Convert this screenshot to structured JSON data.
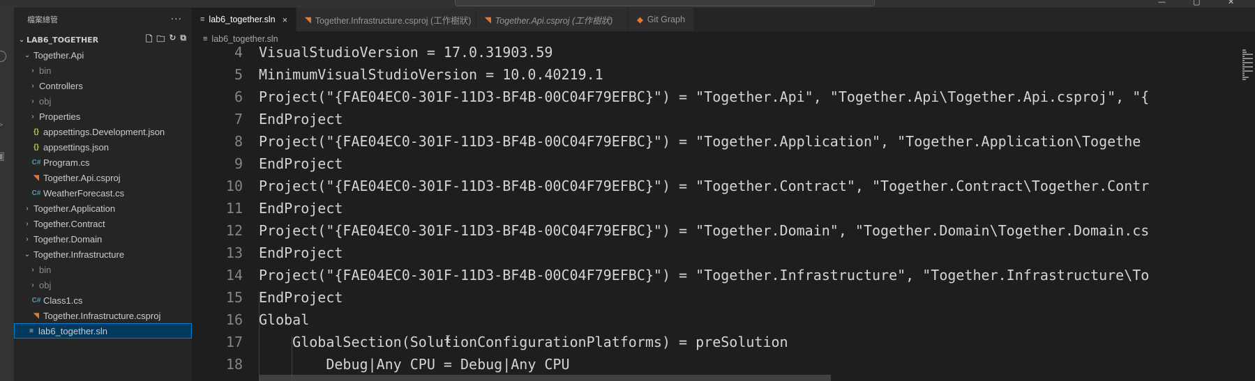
{
  "sidebar": {
    "title": "檔案總管",
    "more": "···",
    "root": "LAB6_TOGETHER",
    "items": [
      {
        "label": "Together.Api",
        "depth": 1,
        "twisty": "open",
        "icon": ""
      },
      {
        "label": "bin",
        "depth": 2,
        "twisty": "closed",
        "icon": "",
        "dim": true
      },
      {
        "label": "Controllers",
        "depth": 2,
        "twisty": "closed",
        "icon": ""
      },
      {
        "label": "obj",
        "depth": 2,
        "twisty": "closed",
        "icon": "",
        "dim": true
      },
      {
        "label": "Properties",
        "depth": 2,
        "twisty": "closed",
        "icon": ""
      },
      {
        "label": "appsettings.Development.json",
        "depth": 2,
        "twisty": "",
        "icon": "json"
      },
      {
        "label": "appsettings.json",
        "depth": 2,
        "twisty": "",
        "icon": "json"
      },
      {
        "label": "Program.cs",
        "depth": 2,
        "twisty": "",
        "icon": "cs"
      },
      {
        "label": "Together.Api.csproj",
        "depth": 2,
        "twisty": "",
        "icon": "rss"
      },
      {
        "label": "WeatherForecast.cs",
        "depth": 2,
        "twisty": "",
        "icon": "cs"
      },
      {
        "label": "Together.Application",
        "depth": 1,
        "twisty": "closed",
        "icon": ""
      },
      {
        "label": "Together.Contract",
        "depth": 1,
        "twisty": "closed",
        "icon": ""
      },
      {
        "label": "Together.Domain",
        "depth": 1,
        "twisty": "closed",
        "icon": ""
      },
      {
        "label": "Together.Infrastructure",
        "depth": 1,
        "twisty": "open",
        "icon": ""
      },
      {
        "label": "bin",
        "depth": 2,
        "twisty": "closed",
        "icon": "",
        "dim": true
      },
      {
        "label": "obj",
        "depth": 2,
        "twisty": "closed",
        "icon": "",
        "dim": true
      },
      {
        "label": "Class1.cs",
        "depth": 2,
        "twisty": "",
        "icon": "cs"
      },
      {
        "label": "Together.Infrastructure.csproj",
        "depth": 2,
        "twisty": "",
        "icon": "rss"
      },
      {
        "label": "lab6_together.sln",
        "depth": 1,
        "twisty": "",
        "icon": "sln",
        "selected": true
      }
    ]
  },
  "tabs": [
    {
      "label": "lab6_together.sln",
      "icon": "sln",
      "active": true,
      "close": "×"
    },
    {
      "label": "Together.Infrastructure.csproj (工作樹狀)",
      "icon": "rss"
    },
    {
      "label": "Together.Api.csproj (工作樹狀)",
      "icon": "rss",
      "italic": true
    },
    {
      "label": "Git Graph",
      "icon": "git"
    }
  ],
  "breadcrumb": "lab6_together.sln",
  "editor": {
    "lines": [
      {
        "n": "4",
        "text": "VisualStudioVersion = 17.0.31903.59"
      },
      {
        "n": "5",
        "text": "MinimumVisualStudioVersion = 10.0.40219.1"
      },
      {
        "n": "6",
        "text": "Project(\"{FAE04EC0-301F-11D3-BF4B-00C04F79EFBC}\") = \"Together.Api\", \"Together.Api\\Together.Api.csproj\", \"{"
      },
      {
        "n": "7",
        "text": "EndProject"
      },
      {
        "n": "8",
        "text": "Project(\"{FAE04EC0-301F-11D3-BF4B-00C04F79EFBC}\") = \"Together.Application\", \"Together.Application\\Togethe"
      },
      {
        "n": "9",
        "text": "EndProject"
      },
      {
        "n": "10",
        "text": "Project(\"{FAE04EC0-301F-11D3-BF4B-00C04F79EFBC}\") = \"Together.Contract\", \"Together.Contract\\Together.Contr"
      },
      {
        "n": "11",
        "text": "EndProject"
      },
      {
        "n": "12",
        "text": "Project(\"{FAE04EC0-301F-11D3-BF4B-00C04F79EFBC}\") = \"Together.Domain\", \"Together.Domain\\Together.Domain.cs"
      },
      {
        "n": "13",
        "text": "EndProject"
      },
      {
        "n": "14",
        "text": "Project(\"{FAE04EC0-301F-11D3-BF4B-00C04F79EFBC}\") = \"Together.Infrastructure\", \"Together.Infrastructure\\To"
      },
      {
        "n": "15",
        "text": "EndProject"
      },
      {
        "n": "16",
        "text": "Global"
      },
      {
        "n": "17",
        "text": "    GlobalSection(SolutionConfigurationPlatforms) = preSolution"
      },
      {
        "n": "18",
        "text": "        Debug|Any CPU = Debug|Any CPU"
      }
    ]
  },
  "colors": {
    "editor_bg": "#1e1e1e",
    "sidebar_bg": "#252526",
    "selection": "#04395e",
    "accent": "#007fd4"
  }
}
